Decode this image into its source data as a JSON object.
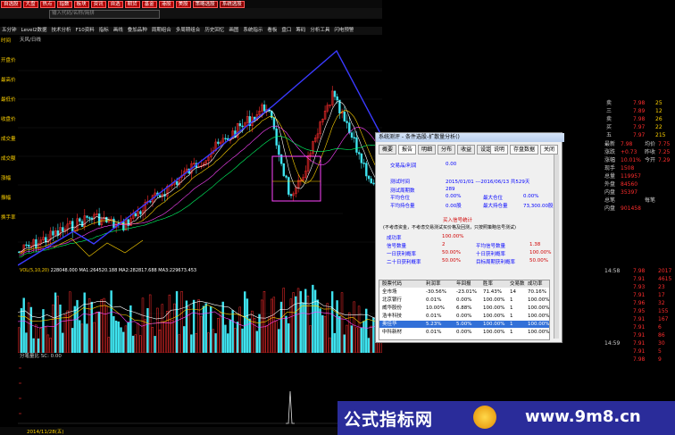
{
  "topbar": {
    "buttons": [
      "自选股",
      "大盘",
      "热点",
      "指数",
      "板块",
      "资讯",
      "自选",
      "期货",
      "基金",
      "港股",
      "美股",
      "券商",
      "理财",
      "自选股"
    ],
    "right_buttons": [
      "策略选股",
      "系统选股"
    ]
  },
  "search": {
    "placeholder": "输入代码/名称/简拼"
  },
  "toolbar": {
    "items": [
      "五分钟",
      "Level2数据",
      "技术分析",
      "F10资料",
      "指标",
      "画线",
      "叠加品种",
      "周期组合",
      "多周期组合",
      "历史回忆",
      "画图",
      "系统指示",
      "看板",
      "盘口",
      "筹码",
      "分析工具",
      "闪电预警"
    ]
  },
  "chart_label": "天风/日线",
  "left_labels": [
    {
      "k": "时间",
      "v": ""
    },
    {
      "k": "开盘价",
      "v": ""
    },
    {
      "k": "最高价",
      "v": ""
    },
    {
      "k": "最低价",
      "v": ""
    },
    {
      "k": "收盘价",
      "v": ""
    },
    {
      "k": "成交量",
      "v": ""
    },
    {
      "k": "成交额",
      "v": ""
    },
    {
      "k": "涨幅",
      "v": ""
    },
    {
      "k": "振幅",
      "v": ""
    },
    {
      "k": "换手率",
      "v": ""
    }
  ],
  "volume_label": "VOL(5,10,20)",
  "volume_values": "228048.000 MA1:264520.188 MA2:282817.688 MA3:229673.453",
  "indicator_label": "分笔量比 SC: 0.00",
  "dialog": {
    "title": "系统测评 - 条件选股-扩散量分析()",
    "tabs": [
      "概要",
      "报告",
      "明细",
      "分布",
      "收益",
      "设定"
    ],
    "buttons": [
      "说明",
      "存盘数据",
      "关闭"
    ],
    "rows": [
      {
        "k": "交易品/利润",
        "v": "0.00"
      },
      {
        "k": "测试时间",
        "v": "2015/01/01 ---2016/06/13  共529天"
      },
      {
        "k": "测试周期数",
        "v": "289"
      },
      {
        "k": "平均仓位",
        "v": "0.00%",
        "k2": "最大仓位",
        "v2": "0.00%"
      },
      {
        "k": "平均持仓量",
        "v": "0.00股",
        "k2": "最大持仓量",
        "v2": "73,300.00股"
      }
    ],
    "section1": "买入信号统计",
    "note": "(不考虑资金，不考虑交易测试买价格及回测，只按照策略信号测试)",
    "stats": [
      {
        "k": "成功率",
        "v": "100.00%"
      },
      {
        "k": "信号数量",
        "v": "2",
        "k2": "平均信号数量",
        "v2": "1.38"
      },
      {
        "k": "一日获利概率",
        "v": "50.00%",
        "k2": "十日获利概率",
        "v2": "100.00%"
      },
      {
        "k": "二十日获利概率",
        "v": "50.00%",
        "k2": "目标周期获利概率",
        "v2": "50.00%"
      }
    ],
    "table_headers": [
      "股票代码",
      "利润率",
      "年回报",
      "胜率",
      "交易数",
      "成功率"
    ],
    "table_rows": [
      [
        "全市场",
        "-30.56%",
        "-23.01%",
        "71.43%",
        "14",
        "70.16%"
      ],
      [
        "北京银行",
        "0.01%",
        "0.00%",
        "100.00%",
        "1",
        "100.00%"
      ],
      [
        "威华股份",
        "10.00%",
        "6.88%",
        "100.00%",
        "1",
        "100.00%"
      ],
      [
        "浩丰科技",
        "0.01%",
        "0.00%",
        "100.00%",
        "1",
        "100.00%"
      ],
      [
        "奥佳华",
        "5.23%",
        "5.00%",
        "100.00%",
        "1",
        "100.00%"
      ],
      [
        "中科新材",
        "0.01%",
        "0.00%",
        "100.00%",
        "1",
        "100.00%"
      ]
    ]
  },
  "right_panel": {
    "rows": [
      {
        "k": "最新",
        "v": "7.98",
        "k2": "均价",
        "v2": "7.75"
      },
      {
        "k": "涨跌",
        "v": "+0.73",
        "k2": "昨收",
        "v2": "7.25"
      },
      {
        "k": "涨幅",
        "v": "10.01%",
        "k2": "今开",
        "v2": "7.29"
      },
      {
        "k": "现手",
        "v": "1508"
      },
      {
        "k": "总量",
        "v": "119957"
      },
      {
        "k": "外盘",
        "v": "84560"
      },
      {
        "k": "内盘",
        "v": "35397"
      },
      {
        "k": "总笔",
        "v": "",
        "k2": "每笔",
        "v2": ""
      },
      {
        "k": "内盘",
        "v": "901458"
      }
    ],
    "ticks": [
      "7.98",
      "7.91",
      "7.93",
      "7.91",
      "7.96",
      "7.95",
      "7.91",
      "7.91",
      "7.91",
      "7.91",
      "7.91",
      "7.98"
    ],
    "tick_vols": [
      "2017",
      "4615",
      "23",
      "17",
      "32",
      "155",
      "167",
      "6",
      "86",
      "30",
      "5",
      "9"
    ],
    "times": [
      "14:58",
      "14:59"
    ],
    "top_rows": [
      {
        "k": "卖",
        "p": "7.98",
        "v": "25"
      },
      {
        "k": "三",
        "p": "7.89",
        "v": "12"
      },
      {
        "k": "卖",
        "p": "7.98",
        "v": "26"
      },
      {
        "k": "买",
        "p": "7.97",
        "v": "22"
      },
      {
        "k": "五",
        "p": "7.97",
        "v": "215"
      }
    ]
  },
  "banner": {
    "title": "公式指标网",
    "url": "www.9m8.cn"
  },
  "bottom_date": "2014/11/28(五)",
  "colors": {
    "up": "#ff2d2d",
    "down": "#3fe4f0",
    "trend": "#3a3aff",
    "ma_yellow": "#ffd200",
    "ma_white": "#ffffff",
    "ma_green": "#00ff66",
    "ma_purple": "#ff44ff",
    "banner": "#2a2c9a"
  }
}
